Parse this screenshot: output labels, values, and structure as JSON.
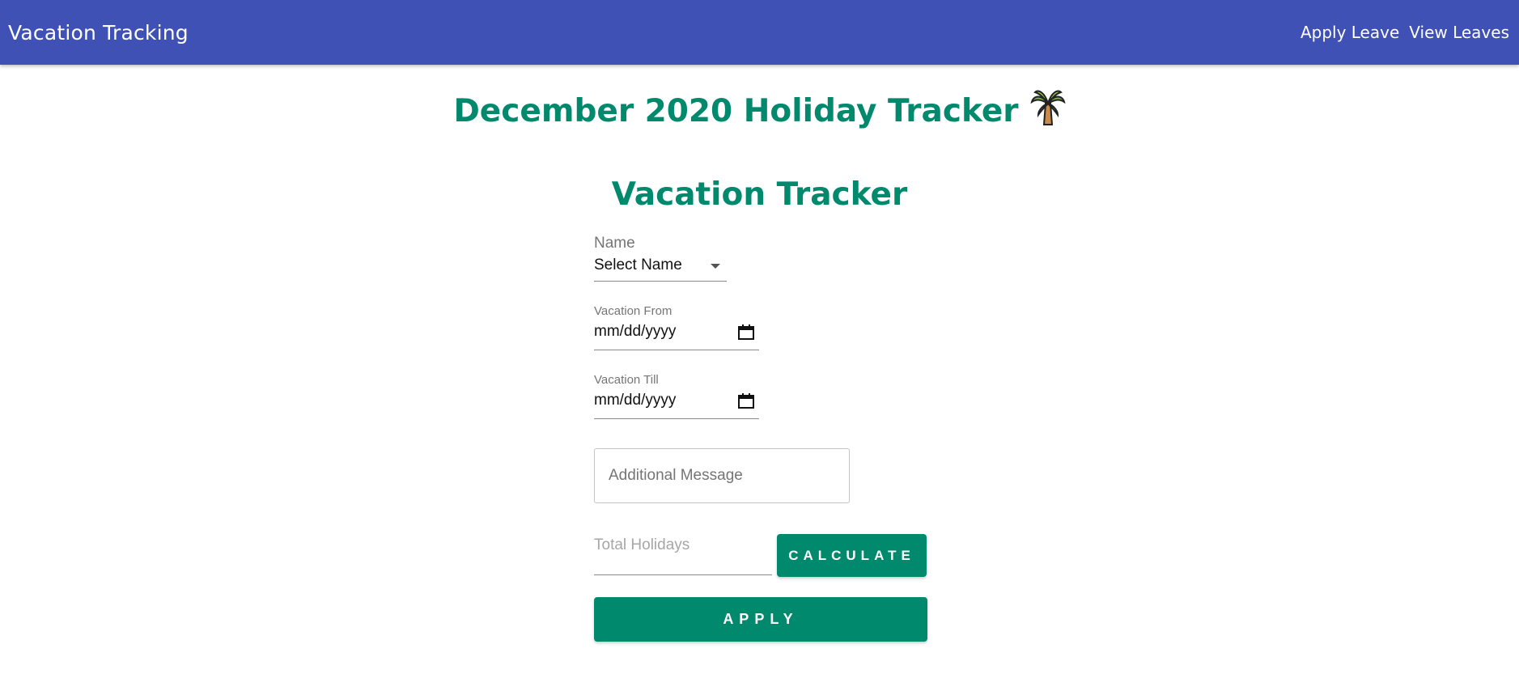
{
  "appbar": {
    "title": "Vacation Tracking",
    "nav": [
      "Apply Leave",
      "View Leaves"
    ],
    "bg_color": "#3f51b5"
  },
  "page": {
    "title": "December 2020 Holiday Tracker",
    "title_icon": "palm-tree-icon",
    "accent_color": "#00896c"
  },
  "form": {
    "title": "Vacation Tracker",
    "name_label": "Name",
    "name_value": "Select Name",
    "from_label": "Vacation From",
    "from_value": "mm/dd/yyyy",
    "till_label": "Vacation Till",
    "till_value": "mm/dd/yyyy",
    "message_placeholder": "Additional Message",
    "total_placeholder": "Total Holidays",
    "calculate_label": "CALCULATE",
    "apply_label": "APPLY"
  }
}
